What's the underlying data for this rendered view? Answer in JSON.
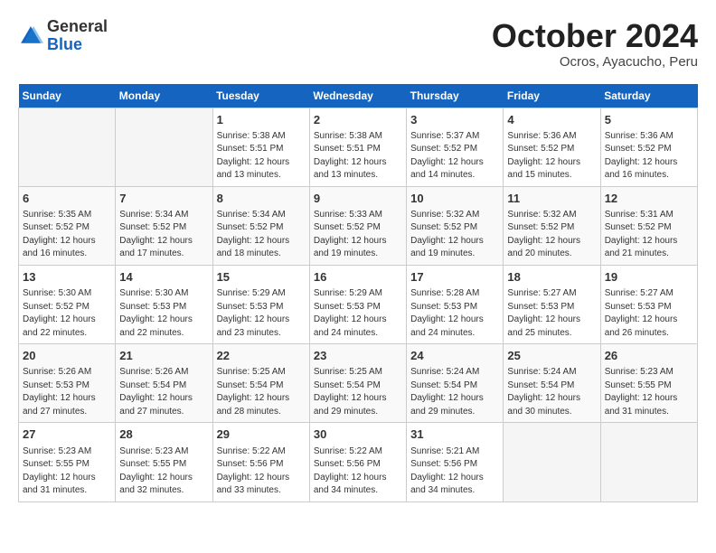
{
  "header": {
    "logo_general": "General",
    "logo_blue": "Blue",
    "month_title": "October 2024",
    "location": "Ocros, Ayacucho, Peru"
  },
  "days_of_week": [
    "Sunday",
    "Monday",
    "Tuesday",
    "Wednesday",
    "Thursday",
    "Friday",
    "Saturday"
  ],
  "weeks": [
    [
      {
        "day": "",
        "info": ""
      },
      {
        "day": "",
        "info": ""
      },
      {
        "day": "1",
        "sunrise": "5:38 AM",
        "sunset": "5:51 PM",
        "daylight": "12 hours and 13 minutes."
      },
      {
        "day": "2",
        "sunrise": "5:38 AM",
        "sunset": "5:51 PM",
        "daylight": "12 hours and 13 minutes."
      },
      {
        "day": "3",
        "sunrise": "5:37 AM",
        "sunset": "5:52 PM",
        "daylight": "12 hours and 14 minutes."
      },
      {
        "day": "4",
        "sunrise": "5:36 AM",
        "sunset": "5:52 PM",
        "daylight": "12 hours and 15 minutes."
      },
      {
        "day": "5",
        "sunrise": "5:36 AM",
        "sunset": "5:52 PM",
        "daylight": "12 hours and 16 minutes."
      }
    ],
    [
      {
        "day": "6",
        "sunrise": "5:35 AM",
        "sunset": "5:52 PM",
        "daylight": "12 hours and 16 minutes."
      },
      {
        "day": "7",
        "sunrise": "5:34 AM",
        "sunset": "5:52 PM",
        "daylight": "12 hours and 17 minutes."
      },
      {
        "day": "8",
        "sunrise": "5:34 AM",
        "sunset": "5:52 PM",
        "daylight": "12 hours and 18 minutes."
      },
      {
        "day": "9",
        "sunrise": "5:33 AM",
        "sunset": "5:52 PM",
        "daylight": "12 hours and 19 minutes."
      },
      {
        "day": "10",
        "sunrise": "5:32 AM",
        "sunset": "5:52 PM",
        "daylight": "12 hours and 19 minutes."
      },
      {
        "day": "11",
        "sunrise": "5:32 AM",
        "sunset": "5:52 PM",
        "daylight": "12 hours and 20 minutes."
      },
      {
        "day": "12",
        "sunrise": "5:31 AM",
        "sunset": "5:52 PM",
        "daylight": "12 hours and 21 minutes."
      }
    ],
    [
      {
        "day": "13",
        "sunrise": "5:30 AM",
        "sunset": "5:52 PM",
        "daylight": "12 hours and 22 minutes."
      },
      {
        "day": "14",
        "sunrise": "5:30 AM",
        "sunset": "5:53 PM",
        "daylight": "12 hours and 22 minutes."
      },
      {
        "day": "15",
        "sunrise": "5:29 AM",
        "sunset": "5:53 PM",
        "daylight": "12 hours and 23 minutes."
      },
      {
        "day": "16",
        "sunrise": "5:29 AM",
        "sunset": "5:53 PM",
        "daylight": "12 hours and 24 minutes."
      },
      {
        "day": "17",
        "sunrise": "5:28 AM",
        "sunset": "5:53 PM",
        "daylight": "12 hours and 24 minutes."
      },
      {
        "day": "18",
        "sunrise": "5:27 AM",
        "sunset": "5:53 PM",
        "daylight": "12 hours and 25 minutes."
      },
      {
        "day": "19",
        "sunrise": "5:27 AM",
        "sunset": "5:53 PM",
        "daylight": "12 hours and 26 minutes."
      }
    ],
    [
      {
        "day": "20",
        "sunrise": "5:26 AM",
        "sunset": "5:53 PM",
        "daylight": "12 hours and 27 minutes."
      },
      {
        "day": "21",
        "sunrise": "5:26 AM",
        "sunset": "5:54 PM",
        "daylight": "12 hours and 27 minutes."
      },
      {
        "day": "22",
        "sunrise": "5:25 AM",
        "sunset": "5:54 PM",
        "daylight": "12 hours and 28 minutes."
      },
      {
        "day": "23",
        "sunrise": "5:25 AM",
        "sunset": "5:54 PM",
        "daylight": "12 hours and 29 minutes."
      },
      {
        "day": "24",
        "sunrise": "5:24 AM",
        "sunset": "5:54 PM",
        "daylight": "12 hours and 29 minutes."
      },
      {
        "day": "25",
        "sunrise": "5:24 AM",
        "sunset": "5:54 PM",
        "daylight": "12 hours and 30 minutes."
      },
      {
        "day": "26",
        "sunrise": "5:23 AM",
        "sunset": "5:55 PM",
        "daylight": "12 hours and 31 minutes."
      }
    ],
    [
      {
        "day": "27",
        "sunrise": "5:23 AM",
        "sunset": "5:55 PM",
        "daylight": "12 hours and 31 minutes."
      },
      {
        "day": "28",
        "sunrise": "5:23 AM",
        "sunset": "5:55 PM",
        "daylight": "12 hours and 32 minutes."
      },
      {
        "day": "29",
        "sunrise": "5:22 AM",
        "sunset": "5:56 PM",
        "daylight": "12 hours and 33 minutes."
      },
      {
        "day": "30",
        "sunrise": "5:22 AM",
        "sunset": "5:56 PM",
        "daylight": "12 hours and 34 minutes."
      },
      {
        "day": "31",
        "sunrise": "5:21 AM",
        "sunset": "5:56 PM",
        "daylight": "12 hours and 34 minutes."
      },
      {
        "day": "",
        "info": ""
      },
      {
        "day": "",
        "info": ""
      }
    ]
  ],
  "labels": {
    "sunrise": "Sunrise:",
    "sunset": "Sunset:",
    "daylight": "Daylight:"
  }
}
